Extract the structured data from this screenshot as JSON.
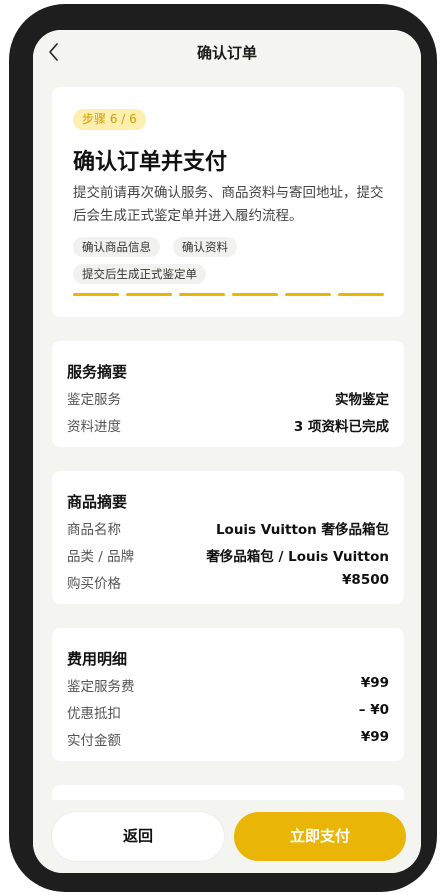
{
  "nav": {
    "title": "确认订单"
  },
  "hero": {
    "step_badge": "步骤 6 / 6",
    "title": "确认订单并支付",
    "description": "提交前请再次确认服务、商品资料与寄回地址，提交后会生成正式鉴定单并进入履约流程。",
    "tags": [
      "确认商品信息",
      "确认资料",
      "提交后生成正式鉴定单"
    ],
    "progress": {
      "current_step": 6,
      "total_steps": 6
    }
  },
  "service_summary": {
    "title": "服务摘要",
    "rows": [
      {
        "label": "鉴定服务",
        "value": "实物鉴定"
      },
      {
        "label": "资料进度",
        "value": "3 项资料已完成"
      }
    ]
  },
  "product_summary": {
    "title": "商品摘要",
    "rows": [
      {
        "label": "商品名称",
        "value": "Louis Vuitton 奢侈品箱包"
      },
      {
        "label": "品类 / 品牌",
        "value": "奢侈品箱包 / Louis Vuitton"
      },
      {
        "label": "购买价格",
        "value": "¥8500"
      }
    ]
  },
  "fee_details": {
    "title": "费用明细",
    "rows": [
      {
        "label": "鉴定服务费",
        "value": "¥99"
      },
      {
        "label": "优惠抵扣",
        "value": "– ¥0"
      },
      {
        "label": "实付金额",
        "value": "¥99"
      }
    ]
  },
  "actions": {
    "back_label": "返回",
    "pay_label": "立即支付"
  },
  "colors": {
    "accent": "#e9b607",
    "badge_bg": "#fcefb0",
    "badge_text": "#d79d00",
    "screen_bg": "#f4f4f1",
    "frame": "#1e1e1e"
  }
}
